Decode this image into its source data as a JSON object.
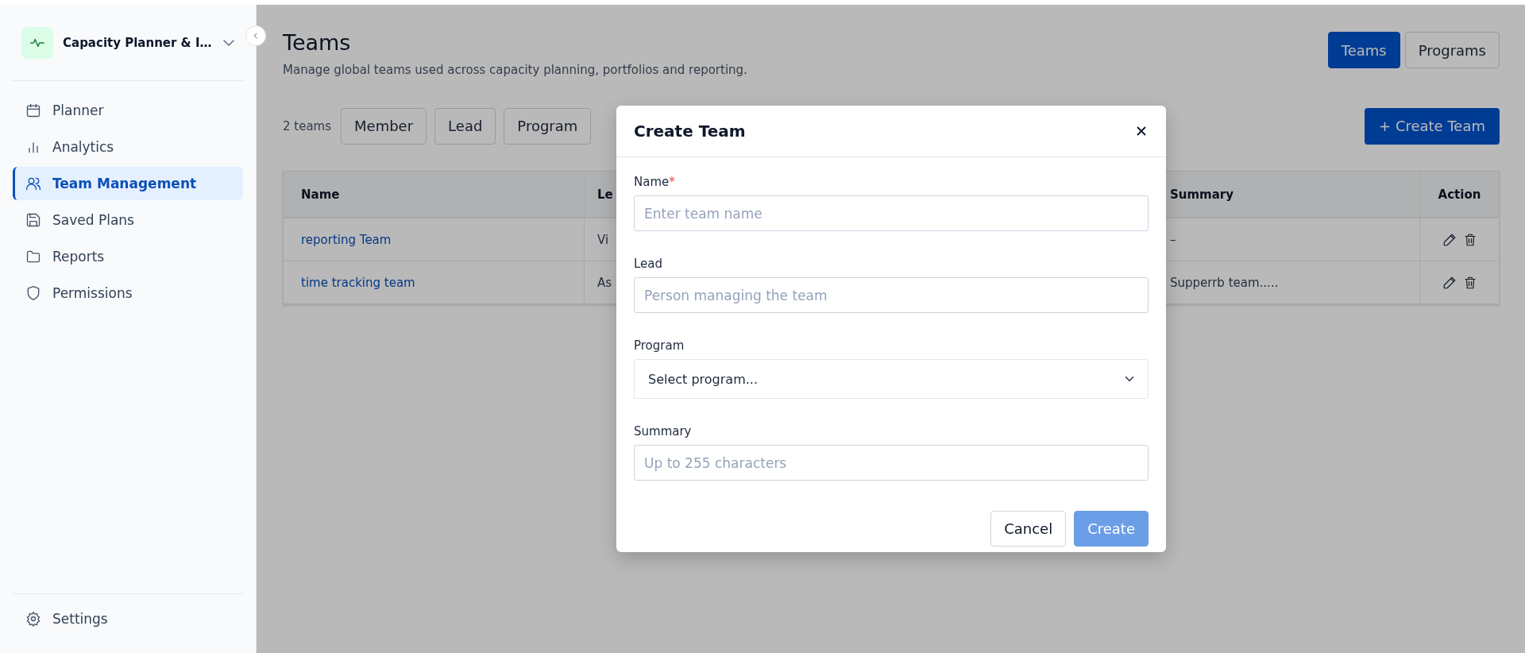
{
  "sidebar": {
    "brand": {
      "title": "Capacity Planner & I…"
    },
    "items": [
      {
        "label": "Planner",
        "selected": false
      },
      {
        "label": "Analytics",
        "selected": false
      },
      {
        "label": "Team Management",
        "selected": true
      },
      {
        "label": "Saved Plans",
        "selected": false
      },
      {
        "label": "Reports",
        "selected": false
      },
      {
        "label": "Permissions",
        "selected": false
      }
    ],
    "footer": {
      "label": "Settings"
    }
  },
  "header": {
    "title": "Teams",
    "subtitle": "Manage global teams used across capacity planning, portfolios and reporting.",
    "view_tabs": [
      {
        "label": "Teams",
        "selected": true
      },
      {
        "label": "Programs",
        "selected": false
      }
    ]
  },
  "toolbar": {
    "count": "2 teams",
    "filters": [
      "Member",
      "Lead",
      "Program"
    ],
    "create_button": "+ Create Team"
  },
  "table": {
    "columns": [
      "Name",
      "Le",
      "Summary",
      "Action"
    ],
    "rows": [
      {
        "name": "reporting Team",
        "lead": "Vi",
        "summary": "–"
      },
      {
        "name": "time tracking team",
        "lead": "As",
        "summary": "Supperrb team....."
      }
    ]
  },
  "modal": {
    "title": "Create Team",
    "fields": [
      {
        "kind": "text",
        "label": "Name",
        "required_mark": "*",
        "placeholder": "Enter team name"
      },
      {
        "kind": "text",
        "label": "Lead",
        "placeholder": "Person managing the team"
      },
      {
        "kind": "select",
        "label": "Program",
        "value": "Select program..."
      },
      {
        "kind": "text",
        "label": "Summary",
        "placeholder": "Up to 255 characters"
      }
    ],
    "buttons": [
      {
        "label": "Cancel",
        "kind": "secondary",
        "disabled": false
      },
      {
        "label": "Create",
        "kind": "primary",
        "disabled": true
      }
    ]
  }
}
